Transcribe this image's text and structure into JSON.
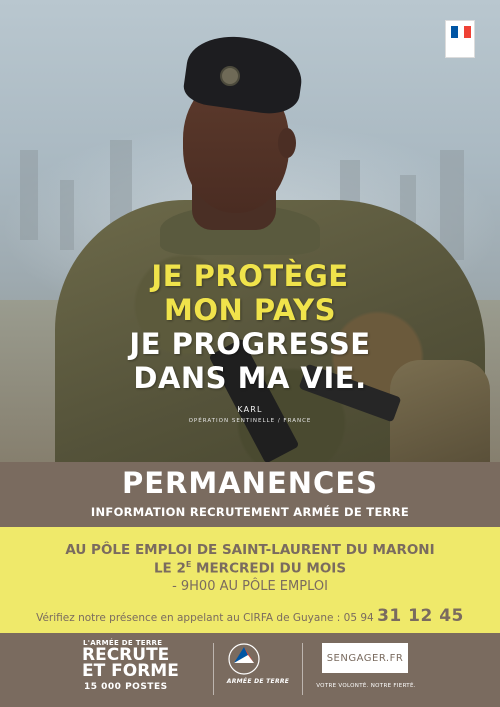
{
  "colors": {
    "brand_brown": "#7a6b5f",
    "highlight_yellow": "#efe96a",
    "slogan_yellow": "#f0e34b",
    "flag_blue": "#0055a4",
    "flag_white": "#ffffff",
    "flag_red": "#ef4135"
  },
  "hero": {
    "slogan_line_1": "JE PROTÈGE",
    "slogan_line_2": "MON PAYS",
    "slogan_line_3": "JE PROGRESSE",
    "slogan_line_4": "DANS MA VIE.",
    "signature_name": "KARL",
    "signature_role": "OPÉRATION SENTINELLE / FRANCE"
  },
  "banner": {
    "title": "PERMANENCES",
    "subtitle": "INFORMATION RECRUTEMENT ARMÉE DE TERRE"
  },
  "details": {
    "location": "AU PÔLE EMPLOI DE SAINT-LAURENT DU MARONI",
    "schedule_prefix": "LE 2",
    "schedule_suffix_sup": "E",
    "schedule_rest": " MERCREDI DU MOIS",
    "time": "- 9H00 AU PÔLE EMPLOI",
    "phone_prefix": "Vérifiez notre présence en appelant au CIRFA de Guyane : 05 94 ",
    "phone_big": "31 12 45"
  },
  "footer": {
    "recruit_small": "L'ARMÉE DE TERRE",
    "recruit_line_1": "RECRUTE",
    "recruit_line_2": "ET FORME",
    "recruit_posts": "15 000 POSTES",
    "army_name": "ARMÉE DE TERRE",
    "emblem_icon": "army-emblem-icon",
    "url": "SENGAGER.FR",
    "motto": "VOTRE VOLONTÉ. NOTRE FIERTÉ."
  }
}
